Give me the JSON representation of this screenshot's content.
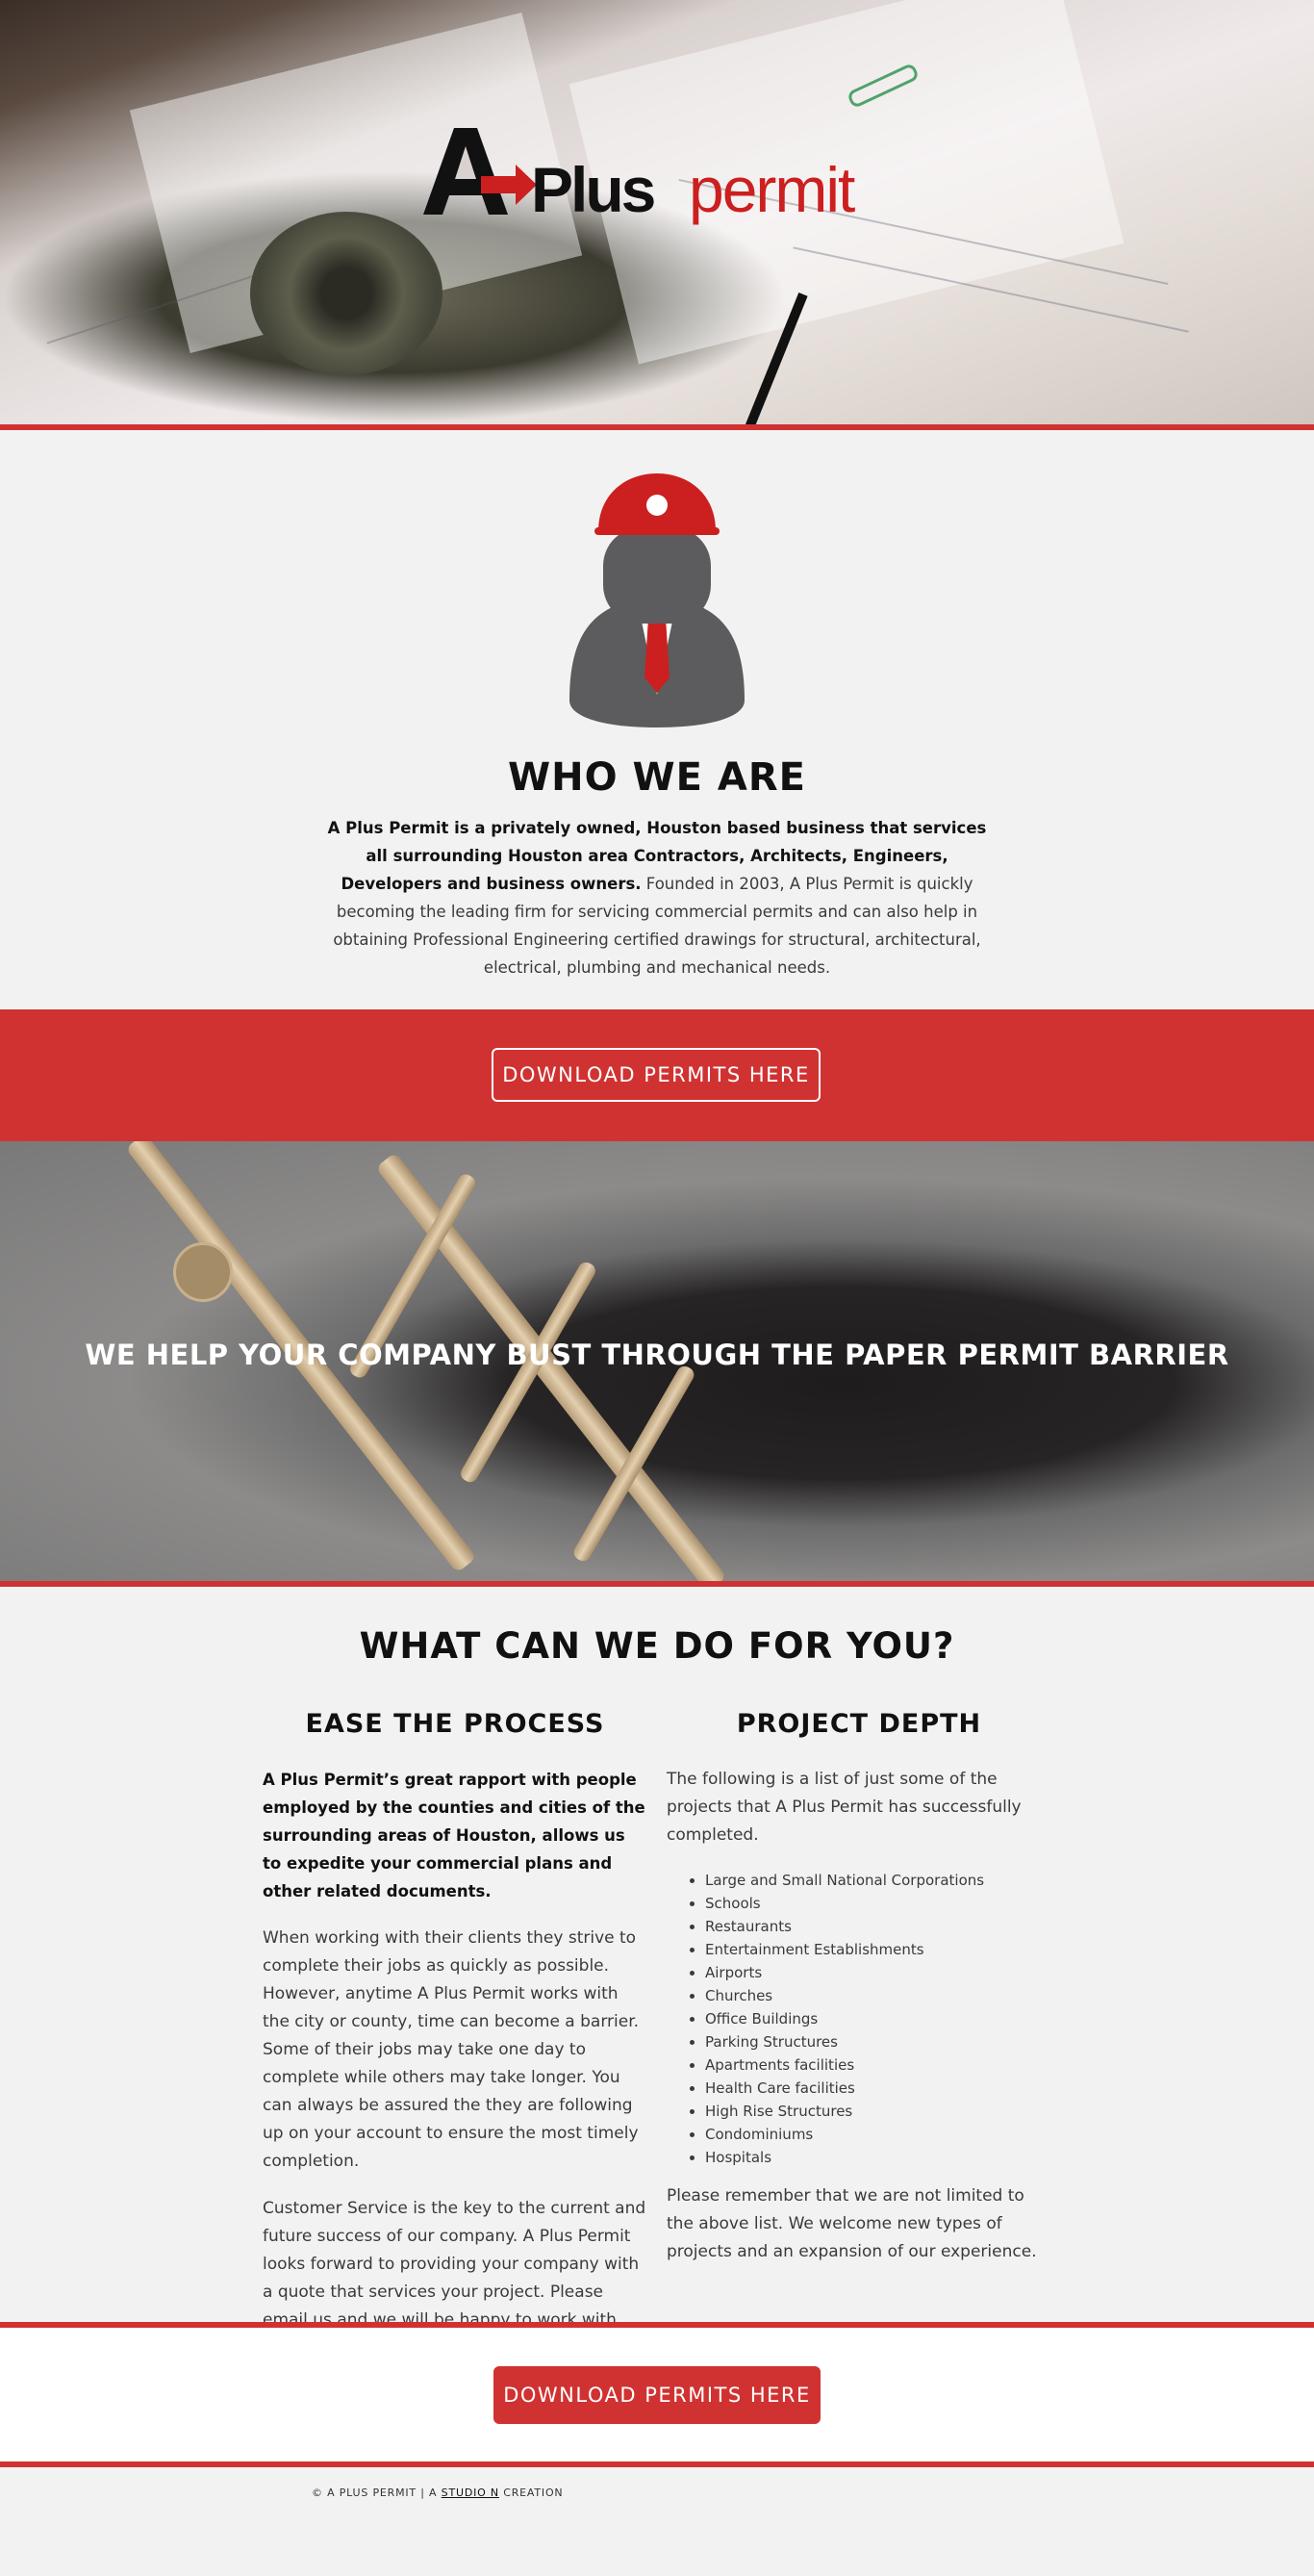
{
  "brand": {
    "logo_letter": "A",
    "logo_plus": "Plus",
    "logo_permit": "permit",
    "logo_alt": "A Plus permit",
    "accent": "#d03232",
    "dark": "#111111"
  },
  "who": {
    "title": "WHO WE ARE",
    "intro_bold": "A Plus Permit is a privately owned, Houston based business that services all surrounding Houston area Contractors, Architects, Engineers, Developers and business owners.",
    "intro_rest": " Founded in 2003, A Plus Permit is quickly becoming the leading firm for servicing commercial permits and can also help in obtaining Professional Engineering certified drawings for structural, architectural, electrical, plumbing and mechanical needs."
  },
  "download_band": {
    "button_label": "DOWNLOAD PERMITS HERE"
  },
  "barrier": {
    "title": "WE HELP YOUR COMPANY BUST THROUGH THE PAPER PERMIT BARRIER"
  },
  "what": {
    "title": "WHAT CAN WE DO FOR YOU?",
    "left": {
      "heading": "EASE THE PROCESS",
      "p1": "A Plus Permit’s great rapport with people employed by the counties and cities of the surrounding areas of Houston, allows us to expedite your commercial plans and other related documents.",
      "p2": "When working with their clients they strive to complete their jobs as quickly as possible. However, anytime A Plus Permit works with the city or county, time can become a barrier. Some of their jobs may take one day to complete while others may take longer. You can always be assured the they are following up on your account to ensure the most timely completion.",
      "p3": "Customer Service is the key to the current and future success of our company. A Plus Permit looks forward to providing your company with a quote that services your project. Please email us and we will be happy to work with you."
    },
    "right": {
      "heading": "PROJECT DEPTH",
      "intro": "The following is a list of just some of the projects that A Plus Permit has successfully completed.",
      "items": [
        "Large and Small National Corporations",
        "Schools",
        "Restaurants",
        "Entertainment Establishments",
        "Airports",
        "Churches",
        "Office Buildings",
        "Parking Structures",
        "Apartments facilities",
        "Health Care facilities",
        "High Rise Structures",
        "Condominiums",
        "Hospitals"
      ],
      "outro": "Please remember that we are not limited to the above list. We welcome new types of projects and an expansion of our experience."
    }
  },
  "cta": {
    "button_label": "DOWNLOAD PERMITS HERE"
  },
  "footer": {
    "prefix": "© A PLUS PERMIT | A ",
    "link": "STUDIO N",
    "suffix": " CREATION"
  }
}
